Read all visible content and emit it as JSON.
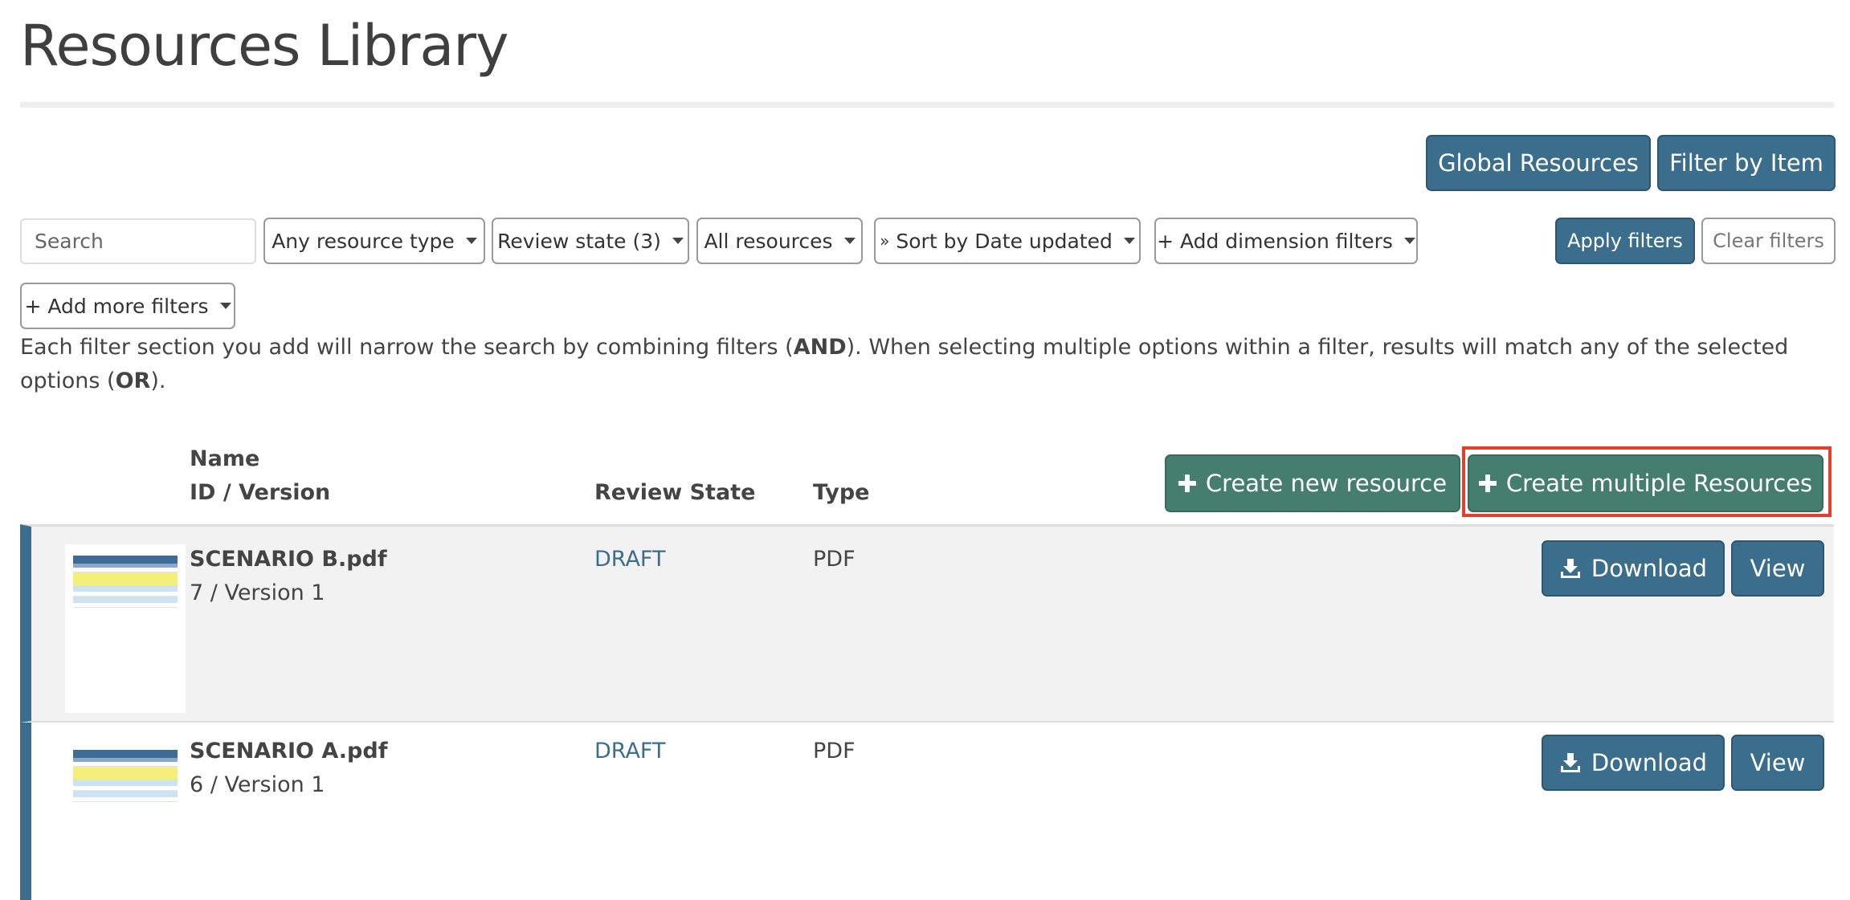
{
  "page": {
    "title": "Resources Library"
  },
  "top_actions": {
    "global_resources": "Global Resources",
    "filter_by_item": "Filter by Item"
  },
  "filters": {
    "search_placeholder": "Search",
    "resource_type": "Any resource type",
    "review_state": "Review state (3)",
    "all_resources": "All resources",
    "sort": "Sort by Date updated",
    "add_dimension": "+ Add dimension filters",
    "add_more": "+ Add more filters",
    "apply": "Apply filters",
    "clear": "Clear filters",
    "help_part1": "Each filter section you add will narrow the search by combining filters (",
    "help_and": "AND",
    "help_part2": "). When selecting multiple options within a filter, results will match any of the selected options (",
    "help_or": "OR",
    "help_part3": ")."
  },
  "table": {
    "headers": {
      "name": "Name",
      "id_version": "ID / Version",
      "review_state": "Review State",
      "type": "Type"
    },
    "create_new": "Create new resource",
    "create_multiple": "Create multiple Resources",
    "download_label": "Download",
    "view_label": "View",
    "rows": [
      {
        "name": "SCENARIO B.pdf",
        "id_version": "7 / Version 1",
        "review_state": "DRAFT",
        "type": "PDF"
      },
      {
        "name": "SCENARIO A.pdf",
        "id_version": "6 / Version 1",
        "review_state": "DRAFT",
        "type": "PDF"
      }
    ]
  },
  "icons": {
    "plus": "plus-icon",
    "download": "download-icon",
    "caret": "caret-down-icon",
    "sort": "double-chevron-down-icon"
  },
  "colors": {
    "primary_blue": "#3b6e8c",
    "primary_green": "#457d6f",
    "highlight_red": "#e0402d",
    "state_link": "#3a6e8f"
  }
}
